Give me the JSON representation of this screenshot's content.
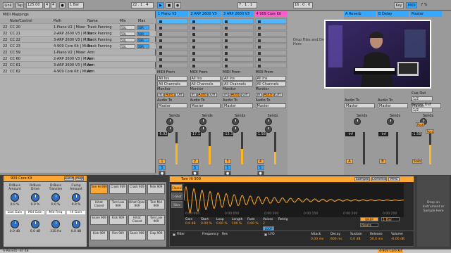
{
  "transport": {
    "link": "Link",
    "tap": "Tap",
    "tempo": "125.00",
    "time_sig_num": "4",
    "time_sig_den": "4",
    "metro": "●",
    "quant": "1 Bar",
    "position": "22 . 1 . 4",
    "loop_start": "7 . 1 . 1",
    "loop_len": "16 . 0 . 0",
    "key": "Key",
    "midi": "MIDI",
    "cpu": "7 %"
  },
  "mapping": {
    "title": "MIDI Mappings",
    "col_note": "Note/Control",
    "col_path": "Path",
    "col_name": "Name",
    "col_min": "Min",
    "col_max": "Max",
    "rows": [
      {
        "ch": "22",
        "ctrl": "CC 20",
        "path": "1-Piano V2 | Mixer",
        "name": "Track Panning",
        "min": "50L",
        "max": "50R"
      },
      {
        "ch": "22",
        "ctrl": "CC 21",
        "path": "2-ARP 2600 V3 | Mixer",
        "name": "Track Panning",
        "min": "50L",
        "max": "50R"
      },
      {
        "ch": "22",
        "ctrl": "CC 22",
        "path": "3-ARP 2600 V3 | Mixer",
        "name": "Track Panning",
        "min": "50L",
        "max": "50R"
      },
      {
        "ch": "22",
        "ctrl": "CC 23",
        "path": "4-909 Core Kit | Mixer",
        "name": "Track Panning",
        "min": "50L",
        "max": "50R"
      },
      {
        "ch": "22",
        "ctrl": "CC 59",
        "path": "1-Piano V2 | Mixer",
        "name": "Arm",
        "min": "",
        "max": ""
      },
      {
        "ch": "22",
        "ctrl": "CC 60",
        "path": "2-ARP 2600 V3 | Mixer",
        "name": "Arm",
        "min": "",
        "max": ""
      },
      {
        "ch": "22",
        "ctrl": "CC 61",
        "path": "3-ARP 2600 V3 | Mixer",
        "name": "Arm",
        "min": "",
        "max": ""
      },
      {
        "ch": "22",
        "ctrl": "CC 62",
        "path": "4-909 Core Kit | Mixer",
        "name": "Arm",
        "min": "",
        "max": ""
      }
    ]
  },
  "tracks": [
    {
      "name": "1 Piano V2",
      "volume": "-6.02",
      "num": "1",
      "color": "#36a8ff"
    },
    {
      "name": "2 ARP 2600 V3",
      "volume": "-17.1",
      "num": "2",
      "color": "#36a8ff"
    },
    {
      "name": "3 ARP 2600 V3",
      "volume": "-13.3",
      "num": "3",
      "color": "#36a8ff"
    },
    {
      "name": "4 909 Core Kit",
      "volume": "-1.58",
      "num": "4",
      "color": "#ff5ccd"
    }
  ],
  "returns": [
    {
      "name": "A Reverb",
      "volume": "-inf",
      "letter": "A"
    },
    {
      "name": "B Delay",
      "volume": "-inf",
      "letter": "B"
    },
    {
      "name": "Master",
      "volume": "-1.58",
      "letter": "Solo"
    }
  ],
  "io": {
    "midi_from": "MIDI From",
    "all_ins": "All Ins",
    "all_channels": "All Channels",
    "monitor": "Monitor",
    "mon_in": "In",
    "mon_auto": "Auto",
    "mon_off": "Off",
    "audio_to": "Audio To",
    "master": "Master",
    "sends": "Sends",
    "drop_text": "Drop Files and Devices Here",
    "cue_out": "Cue Out",
    "cue_val": "1/2",
    "master_out": "Master Out",
    "master_val": "1/2",
    "post": "Post"
  },
  "drumrack": {
    "title": "909 Core Kit",
    "rand": "Rand",
    "map": "Map",
    "macros": [
      {
        "label": "DrBuss Amount",
        "value": "0.0 %"
      },
      {
        "label": "DrBuss Drive",
        "value": "0.0 %"
      },
      {
        "label": "DrBuss Transien",
        "value": "0.0 %"
      },
      {
        "label": "Comp Amount",
        "value": "0.0 %"
      },
      {
        "label": "Low Gain",
        "value": "0.0 dB"
      },
      {
        "label": "Mid Gain",
        "value": "0.0 dB"
      },
      {
        "label": "Mid Freq",
        "value": "310 Hz"
      },
      {
        "label": "Hi Gain",
        "value": "0.0 dB"
      }
    ],
    "pads": [
      "Tom Hi 909",
      "Crash 909",
      "Crash 909",
      "Ride 909",
      "Hihat Closed",
      "Tom Low 909",
      "Hihat Open 909",
      "Tom Mid 909",
      "Snare 909",
      "Kick 909",
      "Hihat Closed",
      "Tom Low 909",
      "Kick 909",
      "Rim 909",
      "Snare 909",
      "Clap 909"
    ]
  },
  "sampler": {
    "title": "Tom Hi 909",
    "tab_sample": "Sample",
    "tab_controls": "Controls",
    "tab_mpe": "MPE",
    "mode_classic": "Classic",
    "mode_1shot": "1-Shot",
    "mode_slice": "Slice",
    "time_0": "0:00:000",
    "time_1": "0:00:050",
    "time_2": "0:00:100",
    "time_3": "0:00:150",
    "time_4": "0:00:200",
    "time_5": "0:00:250",
    "params": [
      {
        "label": "Gain",
        "value": "0.0 dB"
      },
      {
        "label": "Start",
        "value": "0.00 %"
      },
      {
        "label": "Loop",
        "value": "0.00 %"
      },
      {
        "label": "Length",
        "value": "100 %"
      },
      {
        "label": "Fade",
        "value": "0.00 %"
      },
      {
        "label": "Voices",
        "value": "2"
      },
      {
        "label": "Retrig",
        "value": ""
      }
    ],
    "loop_btn": "LOOP",
    "warp": "WARP",
    "beats": "Beats",
    "bar": "1 Bar",
    "filter": "Filter",
    "freq": "Frequency",
    "res": "Res",
    "lfo": "LFO",
    "env_labels": [
      "Attack",
      "Decay",
      "Sustain",
      "Release"
    ],
    "env_values": [
      "0.00 ms",
      "600 ms",
      "0.0 dB",
      "50.0 ms"
    ],
    "volume_label": "Volume",
    "volume_value": "-6.00 dB"
  },
  "drop_hint": "Drop an Instrument or Sample Here",
  "status": {
    "left": "A-Reverb -inf dB",
    "right": "4-909 Core Kit"
  }
}
